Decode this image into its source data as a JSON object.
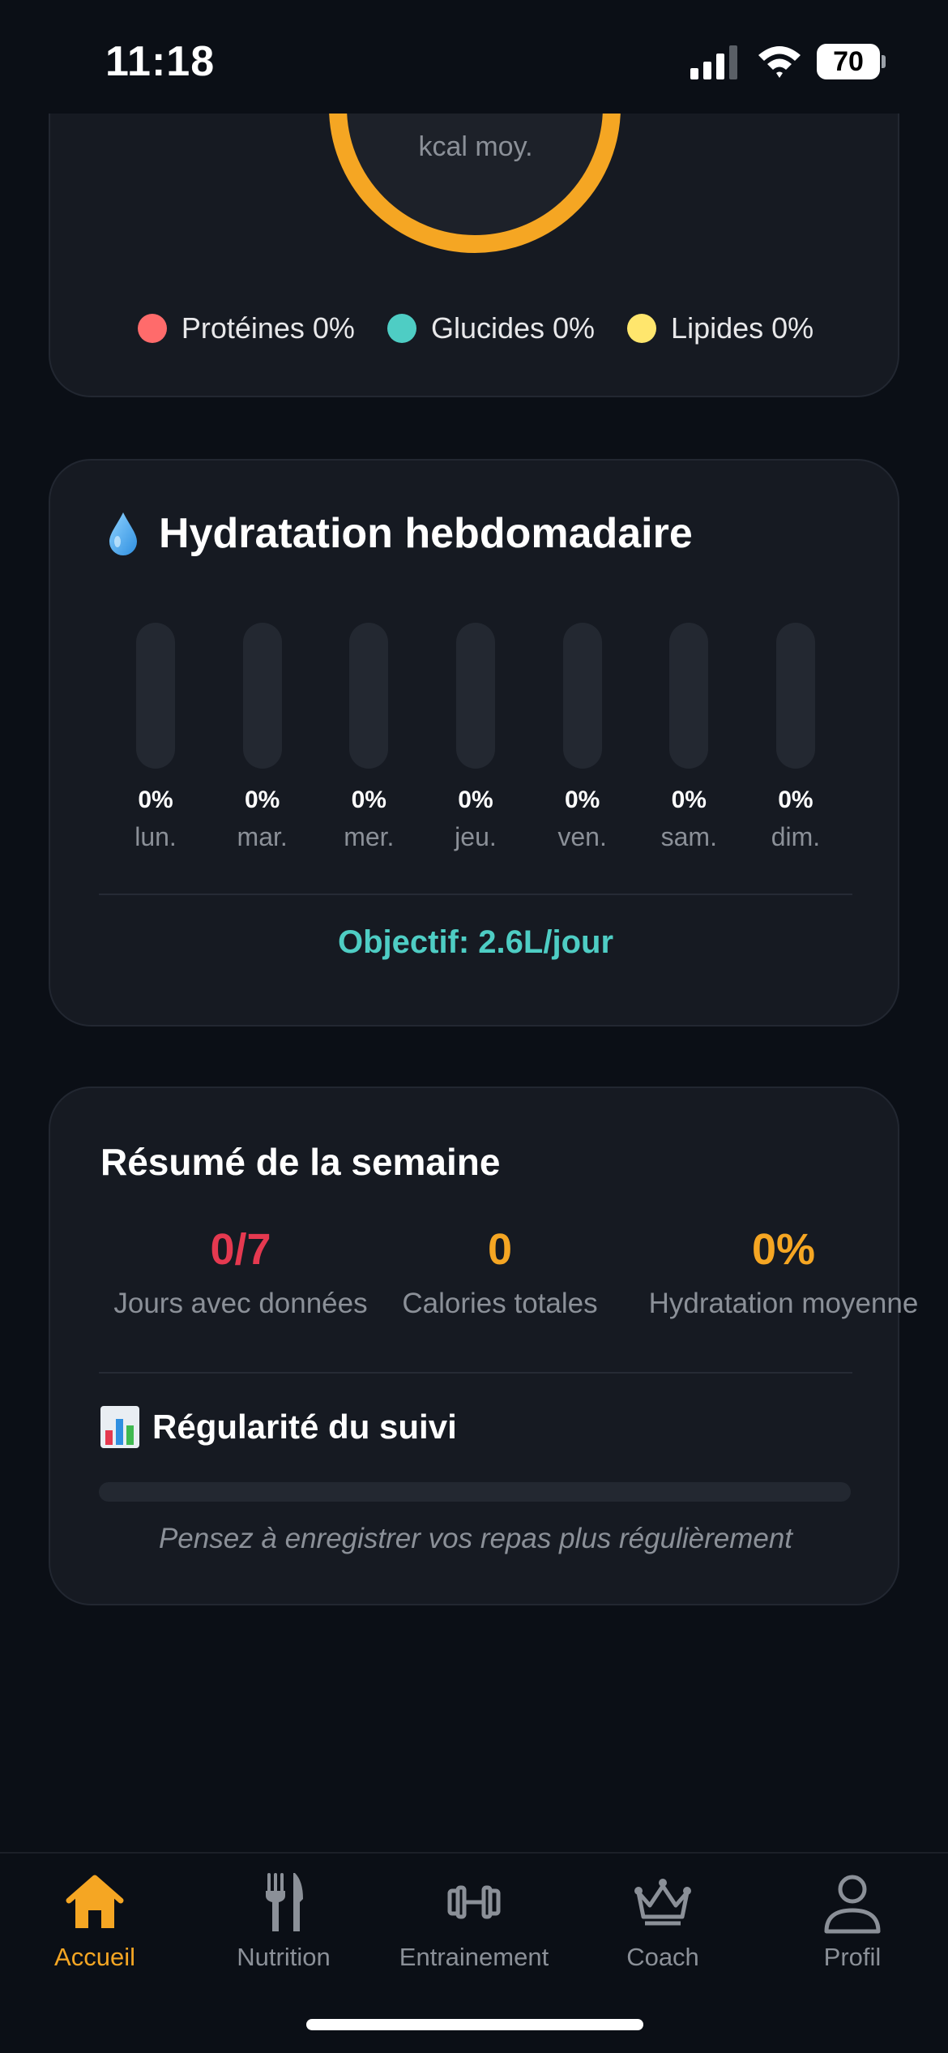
{
  "status_bar": {
    "time": "11:18",
    "battery": "70"
  },
  "macros": {
    "ring_label": "kcal moy.",
    "legend": [
      {
        "label": "Protéines 0%",
        "color": "#ff6b6b"
      },
      {
        "label": "Glucides 0%",
        "color": "#4ecdc4"
      },
      {
        "label": "Lipides 0%",
        "color": "#ffe66d"
      }
    ],
    "ring_color": "#f5a623"
  },
  "hydration": {
    "title": "Hydratation hebdomadaire",
    "icon": "droplet-icon",
    "days": [
      {
        "day": "lun.",
        "pct": "0%"
      },
      {
        "day": "mar.",
        "pct": "0%"
      },
      {
        "day": "mer.",
        "pct": "0%"
      },
      {
        "day": "jeu.",
        "pct": "0%"
      },
      {
        "day": "ven.",
        "pct": "0%"
      },
      {
        "day": "sam.",
        "pct": "0%"
      },
      {
        "day": "dim.",
        "pct": "0%"
      }
    ],
    "goal": "Objectif: 2.6L/jour",
    "goal_color": "#4ecdc4"
  },
  "summary": {
    "title": "Résumé de la semaine",
    "stats": [
      {
        "value": "0/7",
        "label": "Jours avec données",
        "color": "#e53950"
      },
      {
        "value": "0",
        "label": "Calories totales",
        "color": "#f5a623"
      },
      {
        "value": "0%",
        "label": "Hydratation moyenne",
        "color": "#f5a623"
      }
    ],
    "regularity_title": "Régularité du suivi",
    "regularity_icon": "bar-chart-icon",
    "regularity_progress": 0,
    "hint": "Pensez à enregistrer vos repas plus régulièrement"
  },
  "tabs": [
    {
      "label": "Accueil",
      "icon": "home-icon",
      "active": true
    },
    {
      "label": "Nutrition",
      "icon": "fork-knife-icon",
      "active": false
    },
    {
      "label": "Entrainement",
      "icon": "dumbbell-icon",
      "active": false
    },
    {
      "label": "Coach",
      "icon": "crown-icon",
      "active": false
    },
    {
      "label": "Profil",
      "icon": "person-icon",
      "active": false
    }
  ],
  "accent_color": "#f5a623"
}
